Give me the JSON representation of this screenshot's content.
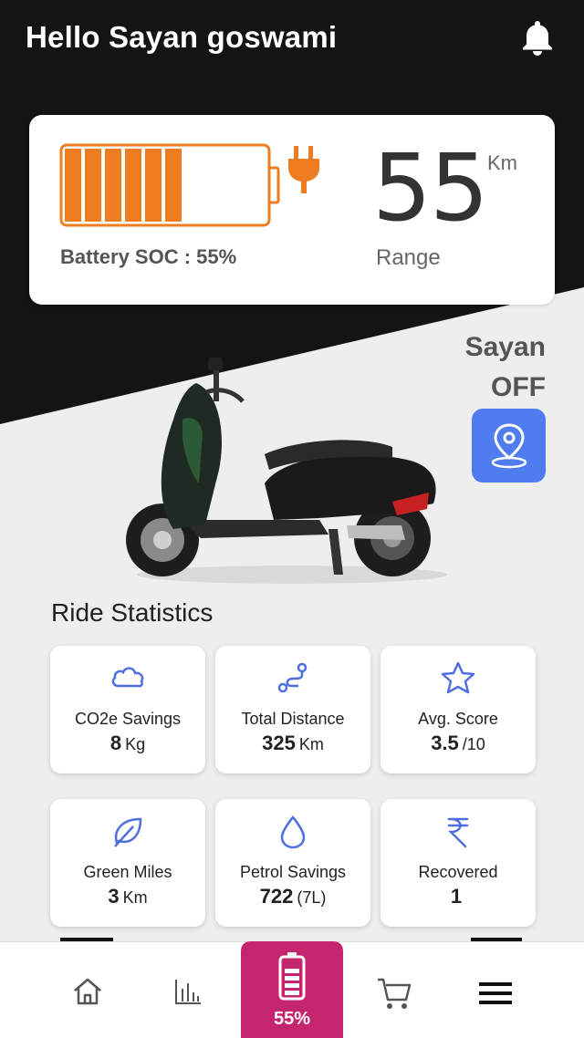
{
  "header": {
    "greeting": "Hello Sayan goswami",
    "icon": "bell-icon"
  },
  "battery": {
    "soc_label": "Battery SOC : 55%",
    "soc_percent": 55,
    "fill_color": "#ee7d22",
    "range_value": "55",
    "range_unit": "Km",
    "range_label": "Range"
  },
  "vehicle": {
    "name": "Sayan",
    "status": "OFF",
    "locate_icon": "location-pin-icon"
  },
  "ride_statistics": {
    "title": "Ride Statistics",
    "cards": [
      {
        "icon": "cloud-icon",
        "label": "CO2e Savings",
        "value": "8",
        "unit": "Kg"
      },
      {
        "icon": "route-icon",
        "label": "Total Distance",
        "value": "325",
        "unit": "Km"
      },
      {
        "icon": "star-icon",
        "label": "Avg. Score",
        "value": "3.5",
        "unit": "/10"
      },
      {
        "icon": "leaf-icon",
        "label": "Green Miles",
        "value": "3",
        "unit": "Km"
      },
      {
        "icon": "drop-icon",
        "label": "Petrol Savings",
        "value": "722",
        "unit": "(7L)"
      },
      {
        "icon": "rupee-icon",
        "label": "Recovered",
        "value": "1",
        "unit": ""
      }
    ]
  },
  "bottom_nav": {
    "items": [
      "home-icon",
      "stats-icon",
      "battery-icon",
      "cart-icon",
      "menu-icon"
    ],
    "center_label": "55%",
    "accent": "#c4256e"
  },
  "colors": {
    "icon_blue": "#4f6fe0",
    "locate_bg": "#4f7df0",
    "header_bg": "#111111"
  }
}
